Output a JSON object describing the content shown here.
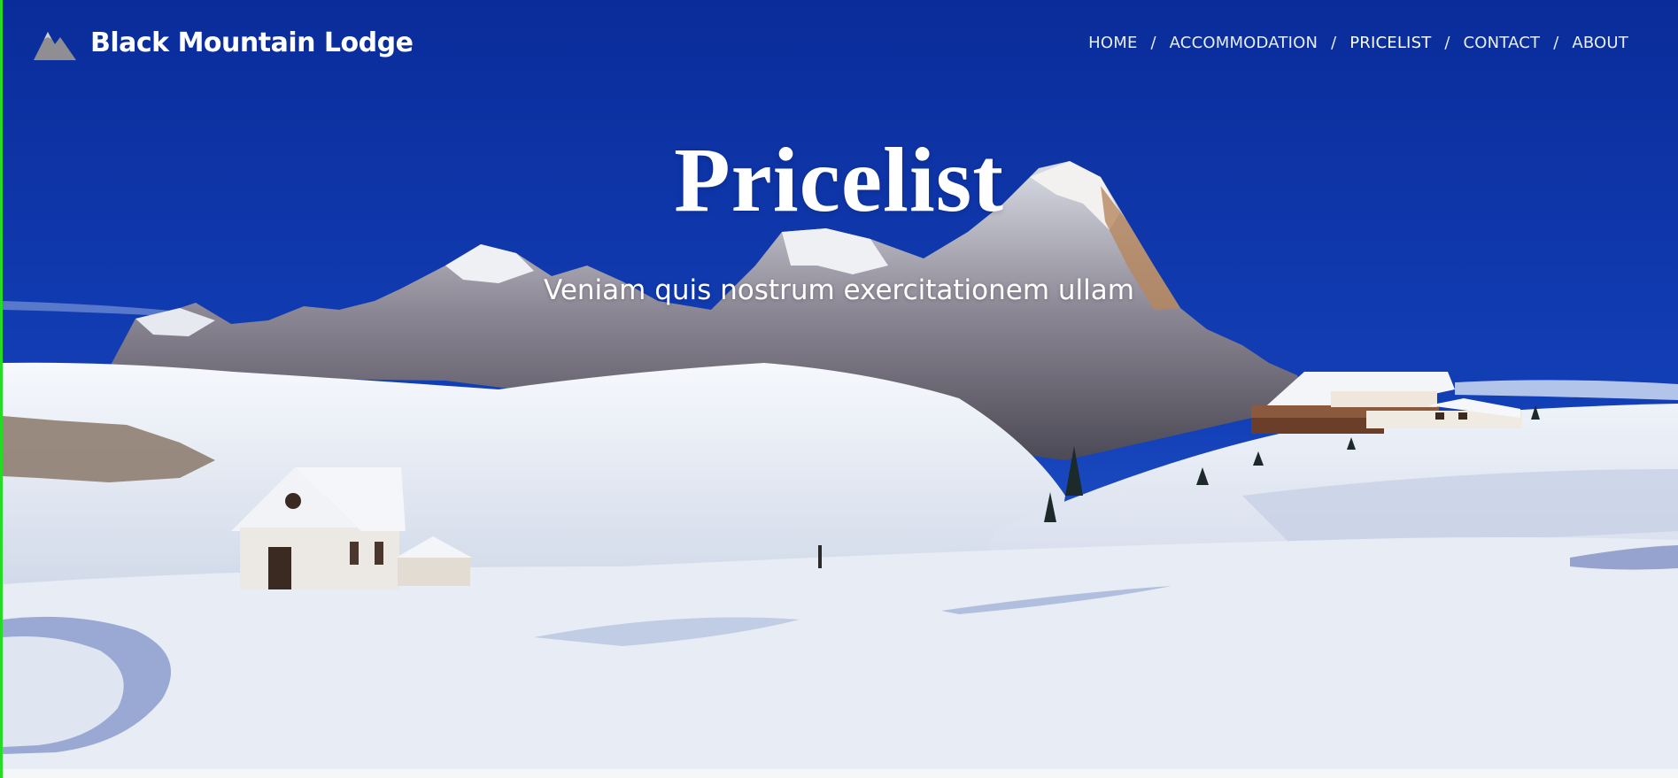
{
  "site": {
    "name": "Black Mountain  Lodge",
    "logo_icon": "mountain-logo-icon"
  },
  "nav": {
    "items": [
      {
        "label": "HOME",
        "active": false
      },
      {
        "label": "ACCOMMODATION",
        "active": false
      },
      {
        "label": "PRICELIST",
        "active": true
      },
      {
        "label": "CONTACT",
        "active": false
      },
      {
        "label": "ABOUT",
        "active": false
      }
    ],
    "separator": "/"
  },
  "hero": {
    "title": "Pricelist",
    "subtitle": "Veniam quis nostrum exercitationem ullam",
    "image_description": "Snowy mountain landscape with chapel and lodge under deep blue sky"
  },
  "colors": {
    "sky_top": "#0b2f9e",
    "sky_bottom": "#2e5fd1",
    "snow": "#e9eef6",
    "accent_edge": "#22dd22",
    "text": "#ffffff"
  }
}
